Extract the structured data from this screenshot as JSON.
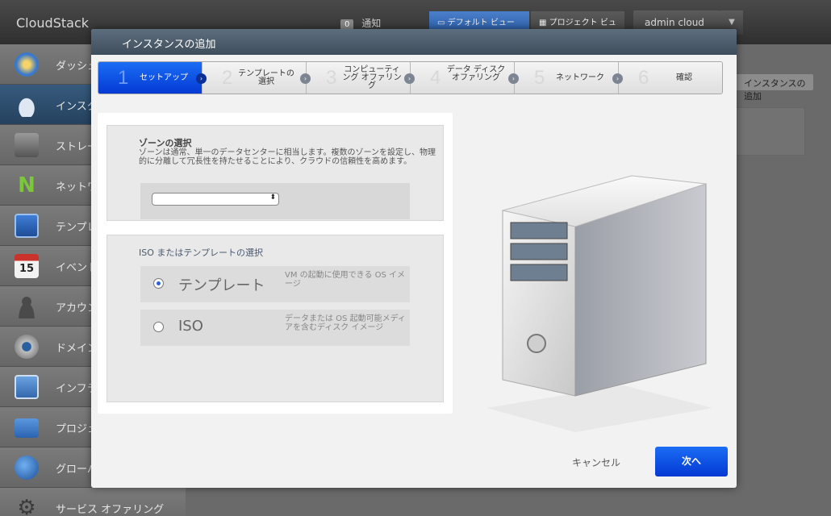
{
  "header": {
    "logo": "CloudStack",
    "notifications_count": "0",
    "notifications_label": "通知",
    "default_view": "デフォルト ビュー",
    "project_view": "プロジェクト ビュー",
    "user": "admin cloud"
  },
  "sidebar": {
    "items": [
      {
        "label": "ダッシュ",
        "icon": "dashboard-icon"
      },
      {
        "label": "インスタ",
        "icon": "cloud-icon"
      },
      {
        "label": "ストレー",
        "icon": "storage-icon"
      },
      {
        "label": "ネットワ",
        "icon": "network-icon"
      },
      {
        "label": "テンプレ",
        "icon": "template-icon"
      },
      {
        "label": "イベント",
        "icon": "calendar-icon"
      },
      {
        "label": "アカウン",
        "icon": "account-icon"
      },
      {
        "label": "ドメイン",
        "icon": "domain-icon"
      },
      {
        "label": "インフラ",
        "icon": "infrastructure-icon"
      },
      {
        "label": "プロジェ",
        "icon": "folder-icon"
      },
      {
        "label": "グローバ",
        "icon": "globe-icon"
      },
      {
        "label": "サービス オファリング",
        "icon": "gear-icon"
      }
    ],
    "calendar_day": "15"
  },
  "content": {
    "add_instance_button": "インスタンスの追加"
  },
  "modal": {
    "title": "インスタンスの追加",
    "steps": [
      {
        "num": "1",
        "label": "セットアップ"
      },
      {
        "num": "2",
        "label": "テンプレートの選択"
      },
      {
        "num": "3",
        "label": "コンピューティング オファリング"
      },
      {
        "num": "4",
        "label": "データ ディスク オファリング"
      },
      {
        "num": "5",
        "label": "ネットワーク"
      },
      {
        "num": "6",
        "label": "確認"
      }
    ],
    "zone": {
      "title": "ゾーンの選択",
      "description": "ゾーンは通常、単一のデータセンターに相当します。複数のゾーンを設定し、物理的に分離して冗長性を持たせることにより、クラウドの信頼性を高めます。",
      "selected": ""
    },
    "iso_template": {
      "title": "ISO またはテンプレートの選択",
      "options": [
        {
          "label": "テンプレート",
          "description": "VM の起動に使用できる OS イメージ",
          "selected": true
        },
        {
          "label": "ISO",
          "description": "データまたは OS 起動可能メディアを含むディスク イメージ",
          "selected": false
        }
      ]
    },
    "cancel_label": "キャンセル",
    "next_label": "次へ"
  }
}
